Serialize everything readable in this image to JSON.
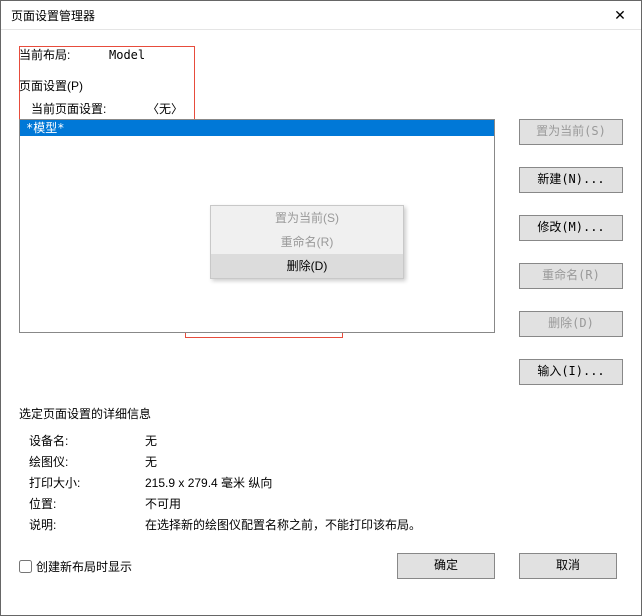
{
  "window": {
    "title": "页面设置管理器"
  },
  "layout_row": {
    "label": "当前布局:",
    "value": "Model"
  },
  "group": {
    "legend": "页面设置(P)",
    "current_label": "当前页面设置:",
    "current_value": "〈无〉",
    "list": {
      "item0": "*模型*"
    }
  },
  "side_buttons": {
    "set_current": "置为当前(S)",
    "new": "新建(N)...",
    "modify": "修改(M)...",
    "rename": "重命名(R)",
    "delete": "删除(D)",
    "import": "输入(I)..."
  },
  "context_menu": {
    "set_current": "置为当前(S)",
    "rename": "重命名(R)",
    "delete": "删除(D)"
  },
  "details": {
    "title": "选定页面设置的详细信息",
    "device_label": "设备名:",
    "device_value": "无",
    "plotter_label": "绘图仪:",
    "plotter_value": "无",
    "size_label": "打印大小:",
    "size_value": "215.9 x 279.4 毫米  纵向",
    "location_label": "位置:",
    "location_value": "不可用",
    "desc_label": "说明:",
    "desc_value": "在选择新的绘图仪配置名称之前，不能打印该布局。"
  },
  "footer": {
    "checkbox_label": "创建新布局时显示",
    "ok": "确定",
    "cancel": "取消"
  }
}
